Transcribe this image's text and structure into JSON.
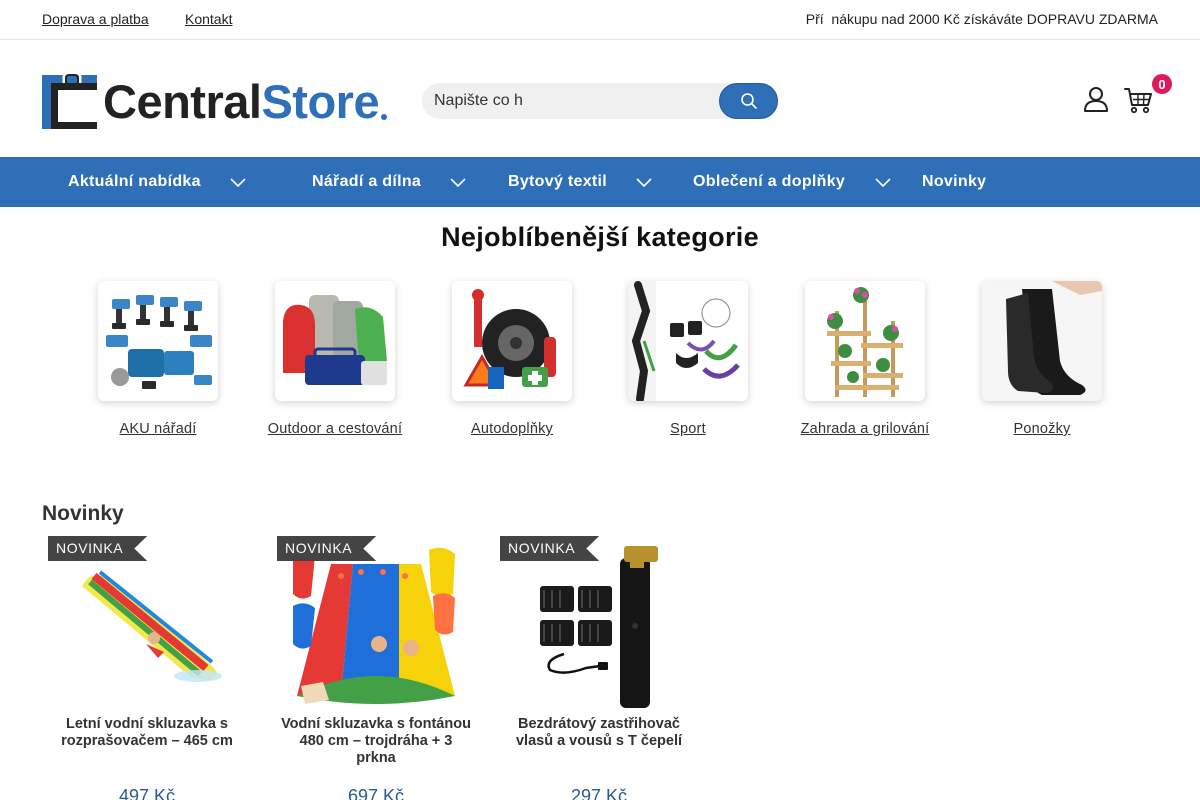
{
  "topbar": {
    "shipping_link": "Doprava a platba",
    "contact_link": "Kontakt",
    "promo": "Pří  nákupu nad 2000 Kč získáváte DOPRAVU ZDARMA"
  },
  "logo": {
    "part1": "Central",
    "part2": "Store"
  },
  "search": {
    "value": "Napište co h",
    "button_icon": "search-icon"
  },
  "header": {
    "cart_count": "0"
  },
  "nav": {
    "items": [
      {
        "label": "Aktuální nabídka",
        "has_dropdown": true
      },
      {
        "label": "Nářadí a dílna",
        "has_dropdown": true
      },
      {
        "label": "Bytový textil",
        "has_dropdown": true
      },
      {
        "label": "Oblečení a doplňky",
        "has_dropdown": true
      },
      {
        "label": "Novinky",
        "has_dropdown": false
      }
    ]
  },
  "categories": {
    "title": "Nejoblíbenější kategorie",
    "items": [
      {
        "label": "AKU nářadí"
      },
      {
        "label": "Outdoor a cestování"
      },
      {
        "label": "Autodoplňky"
      },
      {
        "label": "Sport"
      },
      {
        "label": "Zahrada a grilování"
      },
      {
        "label": "Ponožky"
      }
    ]
  },
  "novinky": {
    "title": "Novinky",
    "products": [
      {
        "badge": "NOVINKA",
        "name": "Letní vodní skluzavka s rozprašovačem – 465 cm",
        "price": "497 Kč"
      },
      {
        "badge": "NOVINKA",
        "name": "Vodní skluzavka s fontánou 480 cm – trojdráha + 3 prkna",
        "price": "697 Kč"
      },
      {
        "badge": "NOVINKA",
        "name": "Bezdrátový zastřihovač vlasů a vousů s T čepelí",
        "price": "297 Kč"
      }
    ]
  },
  "colors": {
    "brand": "#2f6fb8",
    "badge": "#e0195c",
    "text": "#222222"
  }
}
